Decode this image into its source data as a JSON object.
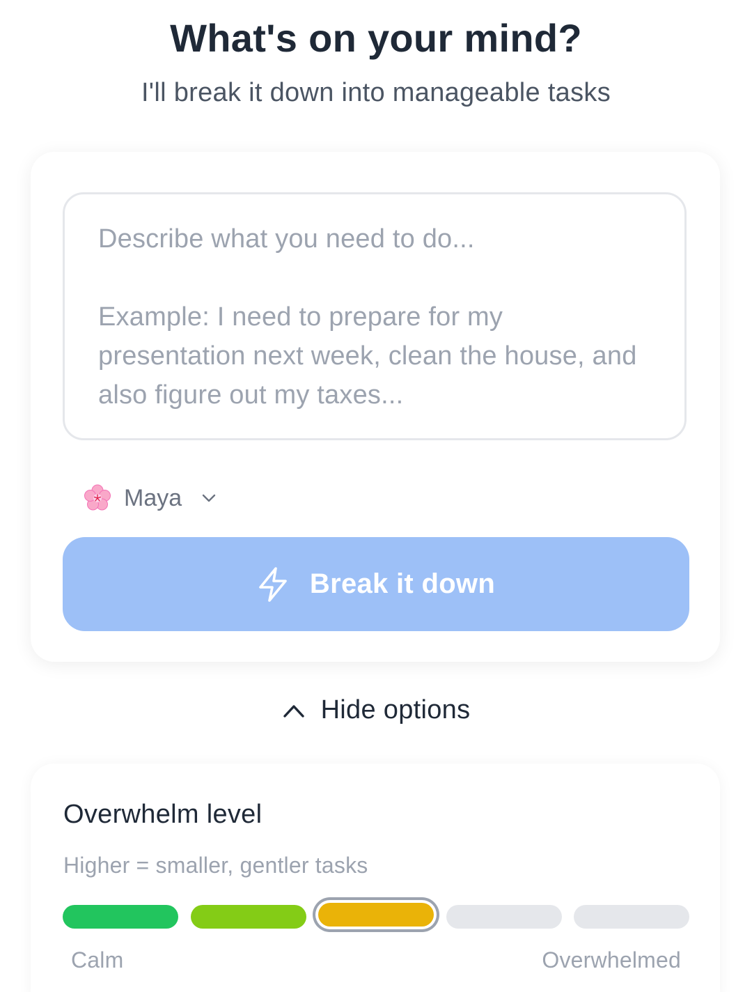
{
  "header": {
    "title": "What's on your mind?",
    "subtitle": "I'll break it down into manageable tasks"
  },
  "input": {
    "placeholder": "Describe what you need to do...\n\nExample: I need to prepare for my presentation next week, clean the house, and also figure out my taxes...",
    "value": ""
  },
  "persona": {
    "icon": "cherry-blossom-icon",
    "name": "Maya",
    "dropdown_icon": "chevron-down-icon"
  },
  "action": {
    "label": "Break it down",
    "icon": "lightning-bolt-icon",
    "color": "#9dc0f7"
  },
  "options_toggle": {
    "label": "Hide options",
    "icon": "chevron-up-icon"
  },
  "overwhelm": {
    "title": "Overwhelm level",
    "hint": "Higher = smaller, gentler tasks",
    "selected_level": 3,
    "levels": [
      {
        "level": 1,
        "color": "#22c55e"
      },
      {
        "level": 2,
        "color": "#84cc16"
      },
      {
        "level": 3,
        "color": "#eab308"
      },
      {
        "level": 4,
        "color": "#e5e7eb"
      },
      {
        "level": 5,
        "color": "#e5e7eb"
      }
    ],
    "min_label": "Calm",
    "max_label": "Overwhelmed"
  }
}
